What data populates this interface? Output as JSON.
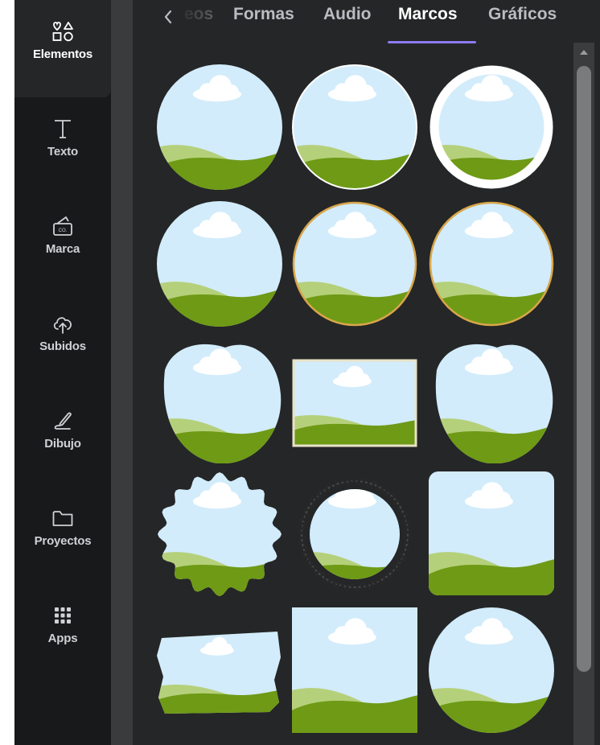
{
  "sidebar": {
    "items": [
      {
        "label": "Elementos",
        "icon": "shapes-icon"
      },
      {
        "label": "Texto",
        "icon": "text-icon"
      },
      {
        "label": "Marca",
        "icon": "brand-kit-icon"
      },
      {
        "label": "Subidos",
        "icon": "cloud-upload-icon"
      },
      {
        "label": "Dibujo",
        "icon": "draw-icon"
      },
      {
        "label": "Proyectos",
        "icon": "folder-icon"
      },
      {
        "label": "Apps",
        "icon": "apps-grid-icon"
      }
    ]
  },
  "tabs": {
    "items": [
      "eos",
      "Formas",
      "Audio",
      "Marcos",
      "Gráficos"
    ],
    "active": "Marcos"
  },
  "frames": {
    "items": [
      {
        "shape": "circle"
      },
      {
        "shape": "circle-thin-border"
      },
      {
        "shape": "circle-white-ring"
      },
      {
        "shape": "circle"
      },
      {
        "shape": "circle-gold-border"
      },
      {
        "shape": "circle-gold-border"
      },
      {
        "shape": "blob"
      },
      {
        "shape": "rectangle-border"
      },
      {
        "shape": "blob"
      },
      {
        "shape": "scalloped"
      },
      {
        "shape": "floral-wreath"
      },
      {
        "shape": "rounded-square"
      },
      {
        "shape": "brush-stroke"
      },
      {
        "shape": "square"
      },
      {
        "shape": "circle"
      }
    ]
  },
  "colors": {
    "sky": "#d2ecfb",
    "hill_light": "#b5d07a",
    "hill_dark": "#6e9a16",
    "accent": "#8b7cf6",
    "gold": "#d8a64a"
  }
}
